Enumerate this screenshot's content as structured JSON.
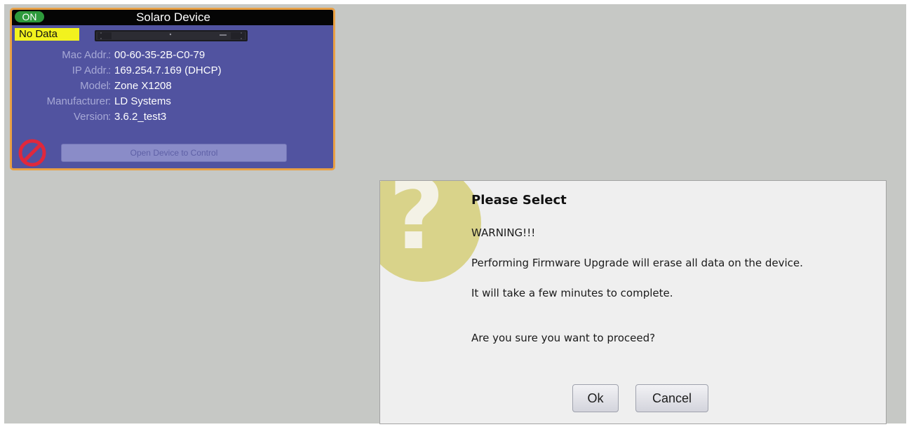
{
  "device_card": {
    "status_badge": "ON",
    "title": "Solaro Device",
    "data_status": "No Data",
    "rows": [
      {
        "label": "Mac Addr.",
        "value": "00-60-35-2B-C0-79"
      },
      {
        "label": "IP Addr.",
        "value": "169.254.7.169 (DHCP)"
      },
      {
        "label": "Model",
        "value": "Zone X1208"
      },
      {
        "label": "Manufacturer",
        "value": "LD Systems"
      },
      {
        "label": "Version",
        "value": "3.6.2_test3"
      }
    ],
    "separator": ":",
    "open_button_label": "Open Device to Control",
    "colors": {
      "card_background": "#5153a0",
      "card_border": "#e9a044",
      "on_badge": "#2e9a3c",
      "no_data_badge": "#f2f21e",
      "no_entry_icon": "#e0283c"
    },
    "icons": [
      "device-thumbnail-icon",
      "no-entry-icon"
    ]
  },
  "dialog": {
    "title": "Please Select",
    "warning": "WARNING!!!",
    "message_line_1": "Performing Firmware Upgrade will erase all data on the device.",
    "message_line_2": "It will take a few minutes to complete.",
    "question": "Are you sure you want to proceed?",
    "ok_label": "Ok",
    "cancel_label": "Cancel",
    "icon": "question-mark-icon",
    "colors": {
      "icon_circle": "#d9d38a",
      "background": "#efefef"
    }
  }
}
